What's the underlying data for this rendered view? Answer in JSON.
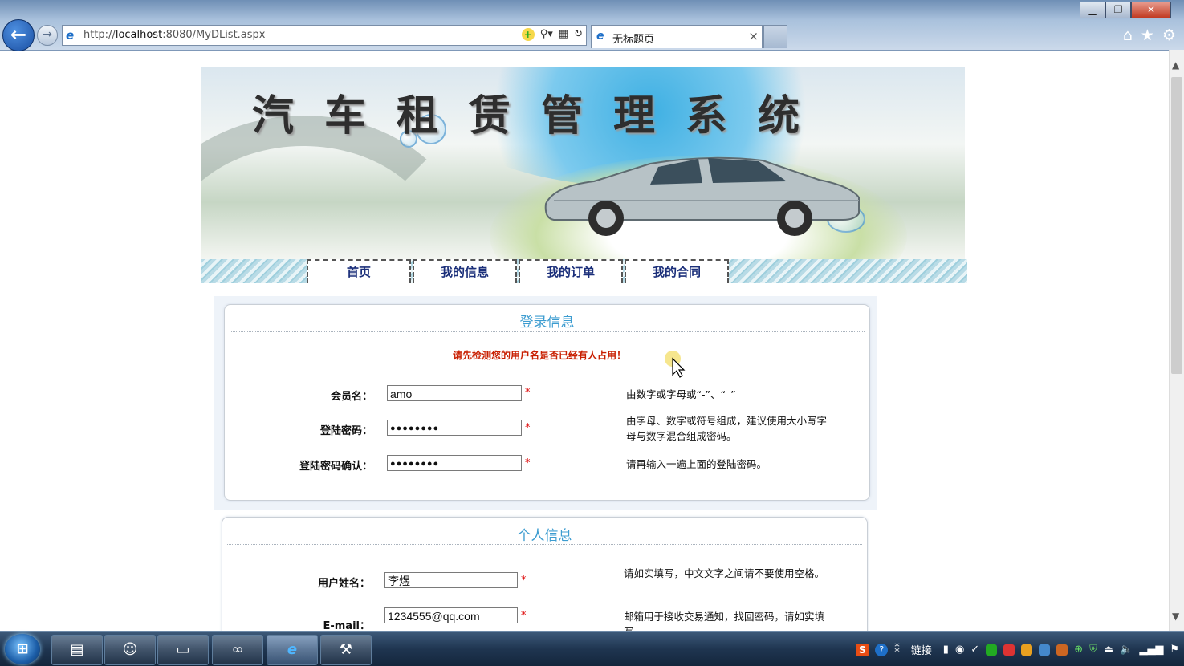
{
  "browser": {
    "url_prefix": "http://",
    "url_host": "localhost",
    "url_rest": ":8080/MyDList.aspx",
    "tab_title": "无标题页",
    "window_buttons": {
      "minimize": "▁",
      "restore": "❐",
      "close": "✕"
    },
    "tab_close": "×"
  },
  "banner": {
    "title": "汽车租赁管理系统"
  },
  "nav": {
    "items": [
      {
        "label": "首页"
      },
      {
        "label": "我的信息"
      },
      {
        "label": "我的订单"
      },
      {
        "label": "我的合同"
      }
    ]
  },
  "login_panel": {
    "title": "登录信息",
    "warning": "请先检测您的用户名是否已经有人占用！",
    "fields": [
      {
        "label": "会员名：",
        "value": "amo",
        "required": "*",
        "hint": "由数字或字母或“-”、“_”"
      },
      {
        "label": "登陆密码：",
        "value": "●●●●●●●●",
        "required": "*",
        "hint": "由字母、数字或符号组成，建议使用大小写字母与数字混合组成密码。"
      },
      {
        "label": "登陆密码确认：",
        "value": "●●●●●●●●",
        "required": "*",
        "hint": "请再输入一遍上面的登陆密码。"
      }
    ]
  },
  "personal_panel": {
    "title": "个人信息",
    "fields": [
      {
        "label": "用户姓名：",
        "value": "李煜",
        "required": "*",
        "hint": "请如实填写，中文文字之间请不要使用空格。"
      },
      {
        "label": "E-mail：",
        "value": "1234555@qq.com",
        "required": "*",
        "hint": "邮箱用于接收交易通知，找回密码，请如实填写。"
      }
    ]
  },
  "taskbar": {
    "tray_text": "链接"
  },
  "colors": {
    "nav_text": "#1b2f7a",
    "panel_title": "#3c9cd0",
    "warning": "#c81e00",
    "required": "#dd0000"
  }
}
